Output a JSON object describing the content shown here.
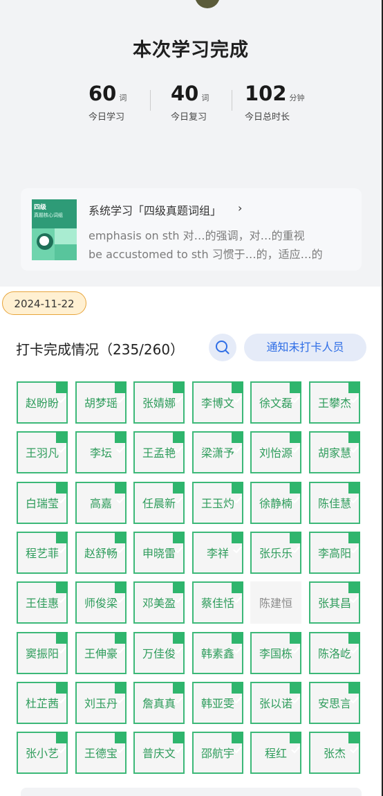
{
  "summary": {
    "title": "本次学习完成",
    "stats": [
      {
        "value": "60",
        "unit": "词",
        "label": "今日学习"
      },
      {
        "value": "40",
        "unit": "词",
        "label": "今日复习"
      },
      {
        "value": "102",
        "unit": "分钟",
        "label": "今日总时长"
      }
    ]
  },
  "book": {
    "cover_title": "四级",
    "cover_subtitle": "真题核心词组",
    "title": "系统学习「四级真题词组」",
    "chevron": "›",
    "examples": [
      "emphasis on sth 对…的强调，对…的重视",
      "be accustomed to sth 习惯于…的，适应…的"
    ]
  },
  "date": "2024-11-22",
  "checkin": {
    "title": "打卡完成情况（235/260）",
    "notify_label": "通知未打卡人员",
    "members": [
      {
        "name": "赵盼盼",
        "done": true
      },
      {
        "name": "胡梦瑶",
        "done": true
      },
      {
        "name": "张婧娜",
        "done": true
      },
      {
        "name": "李博文",
        "done": true
      },
      {
        "name": "徐文磊",
        "done": true
      },
      {
        "name": "王攀杰",
        "done": true
      },
      {
        "name": "王羽凡",
        "done": true
      },
      {
        "name": "李坛",
        "done": true
      },
      {
        "name": "王孟艳",
        "done": true
      },
      {
        "name": "梁潇予",
        "done": true
      },
      {
        "name": "刘怡源",
        "done": true
      },
      {
        "name": "胡家慧",
        "done": true
      },
      {
        "name": "白瑞莹",
        "done": true
      },
      {
        "name": "高嘉",
        "done": true
      },
      {
        "name": "任晨新",
        "done": true
      },
      {
        "name": "王玉灼",
        "done": true
      },
      {
        "name": "徐静楠",
        "done": true
      },
      {
        "name": "陈佳慧",
        "done": true
      },
      {
        "name": "程艺菲",
        "done": true
      },
      {
        "name": "赵舒畅",
        "done": true
      },
      {
        "name": "申晓雷",
        "done": true
      },
      {
        "name": "李祥",
        "done": true
      },
      {
        "name": "张乐乐",
        "done": true
      },
      {
        "name": "李高阳",
        "done": true
      },
      {
        "name": "王佳惠",
        "done": true
      },
      {
        "name": "师俊梁",
        "done": true
      },
      {
        "name": "邓美盈",
        "done": true
      },
      {
        "name": "蔡佳恬",
        "done": true
      },
      {
        "name": "陈建恒",
        "done": false
      },
      {
        "name": "张其昌",
        "done": true
      },
      {
        "name": "窦振阳",
        "done": true
      },
      {
        "name": "王伸豪",
        "done": true
      },
      {
        "name": "万佳俊",
        "done": true
      },
      {
        "name": "韩素鑫",
        "done": true
      },
      {
        "name": "李国栋",
        "done": true
      },
      {
        "name": "陈洛屹",
        "done": true
      },
      {
        "name": "杜芷茜",
        "done": true
      },
      {
        "name": "刘玉丹",
        "done": true
      },
      {
        "name": "詹真真",
        "done": true
      },
      {
        "name": "韩亚雯",
        "done": true
      },
      {
        "name": "张以诺",
        "done": true
      },
      {
        "name": "安思言",
        "done": true
      },
      {
        "name": "张小艺",
        "done": true
      },
      {
        "name": "王德宝",
        "done": true
      },
      {
        "name": "普庆文",
        "done": true
      },
      {
        "name": "邵航宇",
        "done": true
      },
      {
        "name": "程红",
        "done": true
      },
      {
        "name": "张杰",
        "done": true
      }
    ]
  },
  "colors": {
    "accent_green": "#3cb878",
    "accent_blue": "#2f6ee6",
    "date_border": "#e8a43a"
  },
  "icons": {
    "search": "search-icon",
    "check": "checkmark-icon",
    "badge": "medal-icon"
  }
}
